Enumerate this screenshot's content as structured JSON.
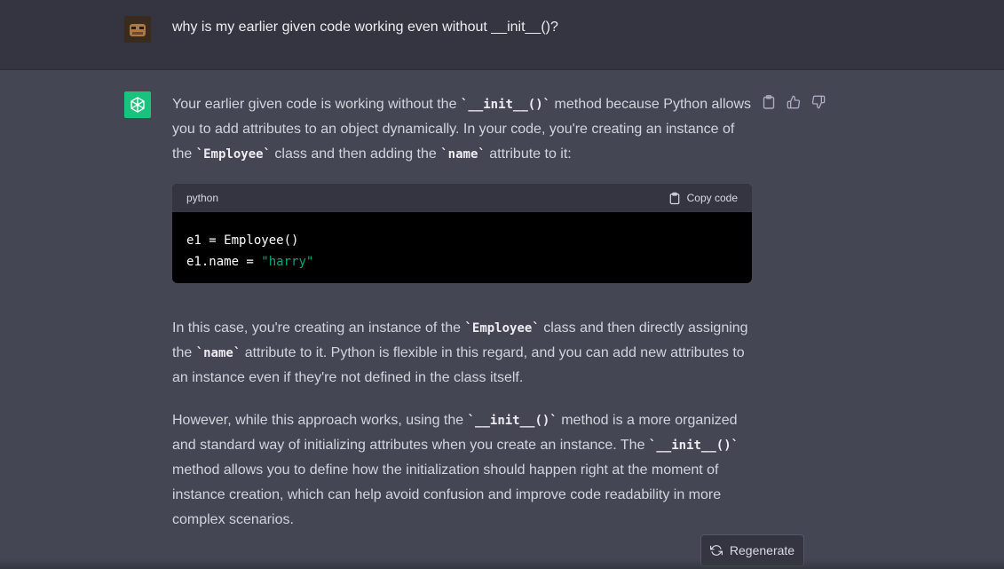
{
  "user": {
    "message": "why is my earlier given code working even without __init__()?"
  },
  "assistant": {
    "p1": {
      "a": "Your earlier given code is working without the ",
      "code1": "`__init__()`",
      "b": " method because Python allows you to add attributes to an object dynamically. In your code, you're creating an instance of the ",
      "code2": "`Employee`",
      "c": " class and then adding the ",
      "code3": "`name`",
      "d": " attribute to it:"
    },
    "codeblock": {
      "language": "python",
      "copy_label": "Copy code",
      "line1": "e1 = Employee()",
      "line2_prefix": "e1.name = ",
      "line2_string": "\"harry\""
    },
    "p2": {
      "a": "In this case, you're creating an instance of the ",
      "code1": "`Employee`",
      "b": " class and then directly assigning the ",
      "code2": "`name`",
      "c": " attribute to it. Python is flexible in this regard, and you can add new attributes to an instance even if they're not defined in the class itself."
    },
    "p3": {
      "a": "However, while this approach works, using the ",
      "code1": "`__init__()`",
      "b": " method is a more organized and standard way of initializing attributes when you create an instance. The ",
      "code2": "`__init__()`",
      "c": " method allows you to define how the initialization should happen right at the moment of instance creation, which can help avoid confusion and improve code readability in more complex scenarios."
    }
  },
  "regenerate_label": "Regenerate",
  "icons": {
    "user_avatar": "user-avatar",
    "assistant_avatar": "openai-logo-icon",
    "copy": "clipboard-icon",
    "thumbs_up": "thumbs-up-icon",
    "thumbs_down": "thumbs-down-icon",
    "regenerate": "refresh-icon"
  },
  "colors": {
    "assistant_accent": "#19c37d",
    "code_string": "#00a67d"
  }
}
